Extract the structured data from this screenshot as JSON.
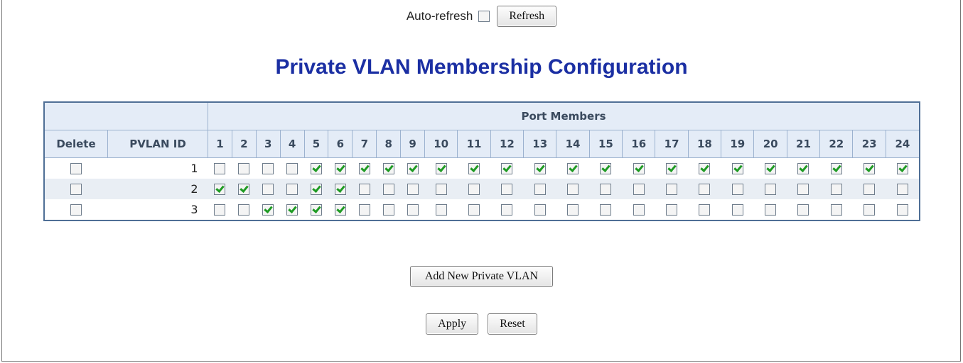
{
  "header": {
    "autorefresh_label": "Auto-refresh",
    "autorefresh_checked": false,
    "refresh_label": "Refresh"
  },
  "title": "Private VLAN Membership Configuration",
  "table": {
    "port_members_header": "Port Members",
    "delete_header": "Delete",
    "pvlan_id_header": "PVLAN ID",
    "ports": [
      "1",
      "2",
      "3",
      "4",
      "5",
      "6",
      "7",
      "8",
      "9",
      "10",
      "11",
      "12",
      "13",
      "14",
      "15",
      "16",
      "17",
      "18",
      "19",
      "20",
      "21",
      "22",
      "23",
      "24"
    ],
    "rows": [
      {
        "delete": false,
        "pvlan_id": "1",
        "members": [
          false,
          false,
          false,
          false,
          true,
          true,
          true,
          true,
          true,
          true,
          true,
          true,
          true,
          true,
          true,
          true,
          true,
          true,
          true,
          true,
          true,
          true,
          true,
          true
        ]
      },
      {
        "delete": false,
        "pvlan_id": "2",
        "members": [
          true,
          true,
          false,
          false,
          true,
          true,
          false,
          false,
          false,
          false,
          false,
          false,
          false,
          false,
          false,
          false,
          false,
          false,
          false,
          false,
          false,
          false,
          false,
          false
        ]
      },
      {
        "delete": false,
        "pvlan_id": "3",
        "members": [
          false,
          false,
          true,
          true,
          true,
          true,
          false,
          false,
          false,
          false,
          false,
          false,
          false,
          false,
          false,
          false,
          false,
          false,
          false,
          false,
          false,
          false,
          false,
          false
        ]
      }
    ]
  },
  "buttons": {
    "add_label": "Add New Private VLAN",
    "apply_label": "Apply",
    "reset_label": "Reset"
  },
  "colors": {
    "title": "#1b2fa3",
    "header_bg": "#e4ecf7",
    "check": "#1f9b24"
  }
}
